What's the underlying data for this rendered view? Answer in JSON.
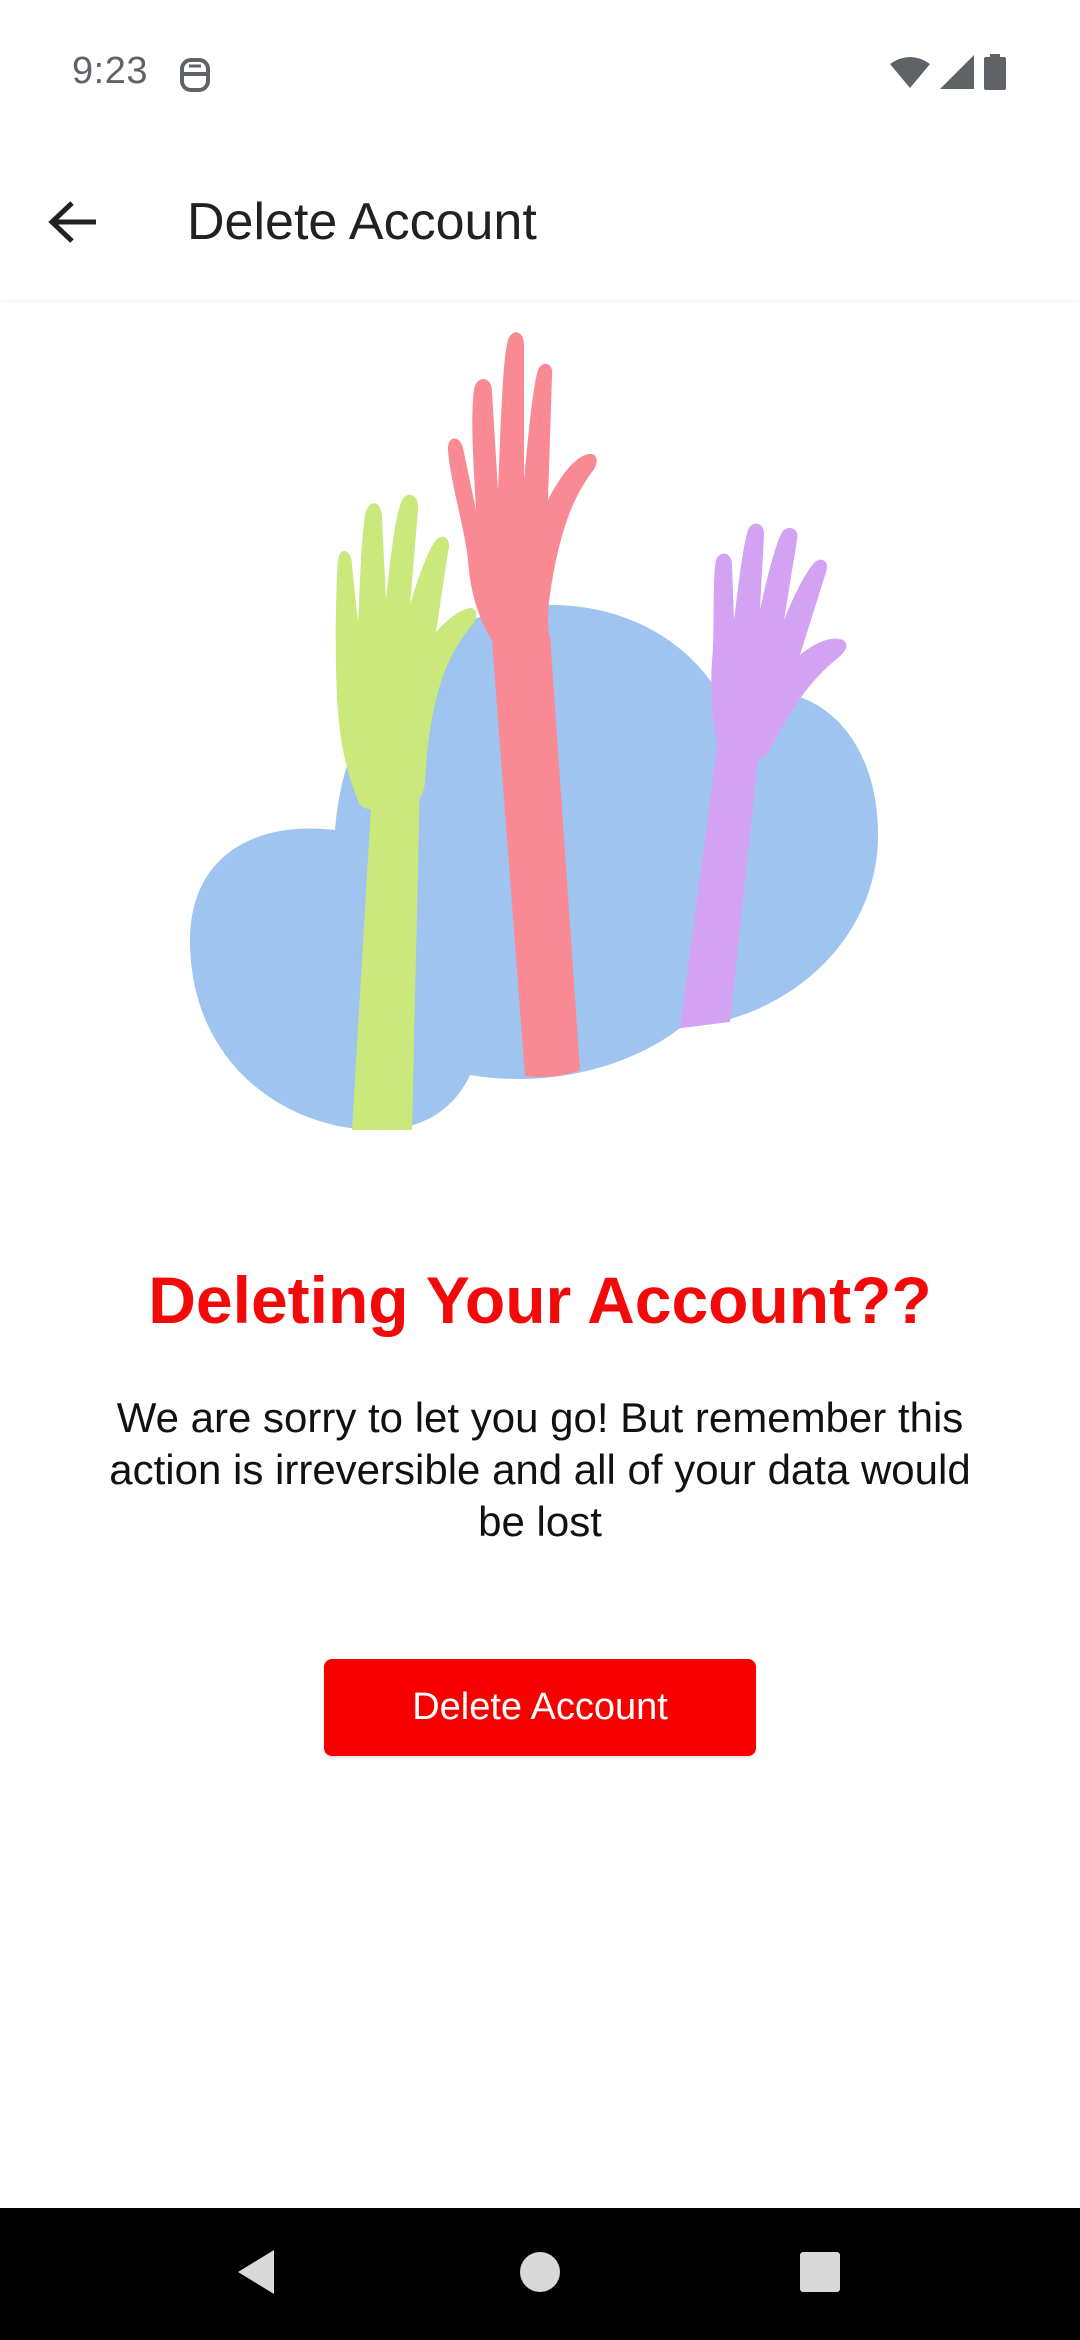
{
  "status_bar": {
    "time": "9:23",
    "icons": [
      "notification-icon",
      "wifi-icon",
      "signal-icon",
      "battery-icon"
    ]
  },
  "app_bar": {
    "title": "Delete Account",
    "back_icon": "arrow-back-icon"
  },
  "content": {
    "headline": "Deleting Your Account??",
    "message": "We are sorry to let you go! But remember this action is irreversible and all of your data would be lost",
    "button_label": "Delete Account"
  },
  "nav_bar": {
    "icons": [
      "back-triangle-icon",
      "home-circle-icon",
      "recents-square-icon"
    ]
  },
  "colors": {
    "accent_red": "#f70000",
    "headline_red": "#f20a0a",
    "cloud_blue": "#9fc4f0",
    "hand_green": "#cbe87c",
    "hand_pink": "#f98a94",
    "hand_purple": "#d4a2f3"
  }
}
